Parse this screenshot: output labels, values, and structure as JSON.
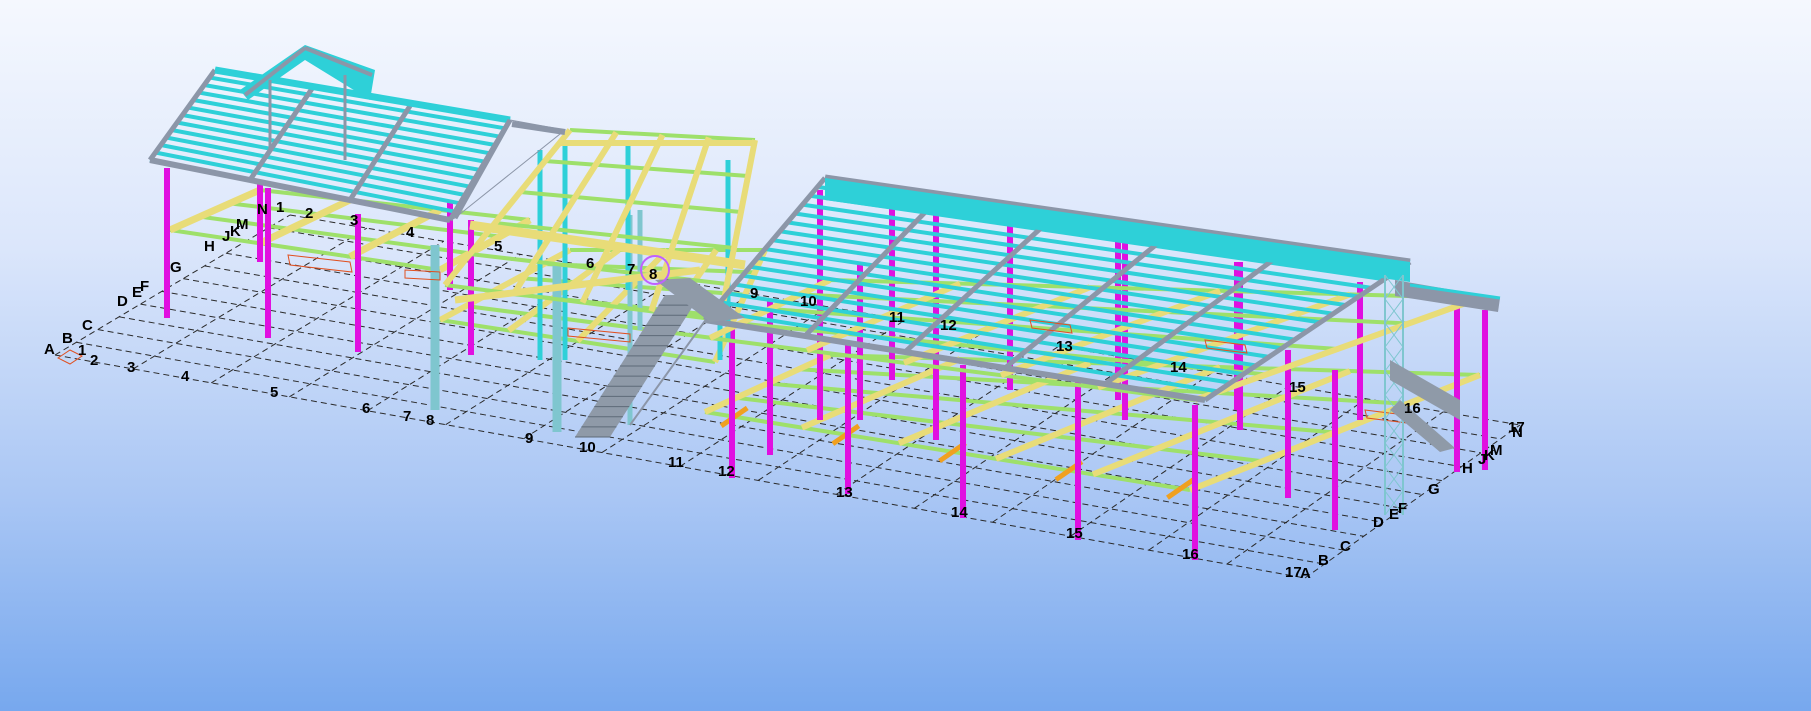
{
  "viewport": {
    "grid_axis_labels": {
      "numbers_front": [
        "1",
        "2",
        "3",
        "4",
        "5",
        "6",
        "7",
        "8",
        "9",
        "10",
        "11",
        "12",
        "13",
        "14",
        "15",
        "16",
        "17"
      ],
      "letters_left": [
        "A",
        "B",
        "C",
        "D",
        "E",
        "F",
        "G",
        "H",
        "J",
        "K",
        "M",
        "N"
      ],
      "letters_right": [
        "A",
        "B",
        "C",
        "D",
        "E",
        "F",
        "G",
        "H",
        "J",
        "K",
        "M",
        "N"
      ],
      "numbers_upper_left": [
        "1",
        "2",
        "3",
        "4",
        "5",
        "6",
        "7",
        "8"
      ],
      "numbers_upper_right": [
        "9",
        "10",
        "11",
        "12",
        "13",
        "14",
        "15",
        "16",
        "17"
      ]
    },
    "colors": {
      "column": "#e010e0",
      "roof_beam": "#2ed0d8",
      "rafter": "#8c96a8",
      "floor_beam": "#9ee06a",
      "floor_girder": "#e8dc78",
      "grey_column": "#7fc6cf",
      "stair": "#8f9aa8",
      "grid_line": "#2a2a2a",
      "opening": "#e05020",
      "brace_orange": "#f0a020"
    }
  }
}
